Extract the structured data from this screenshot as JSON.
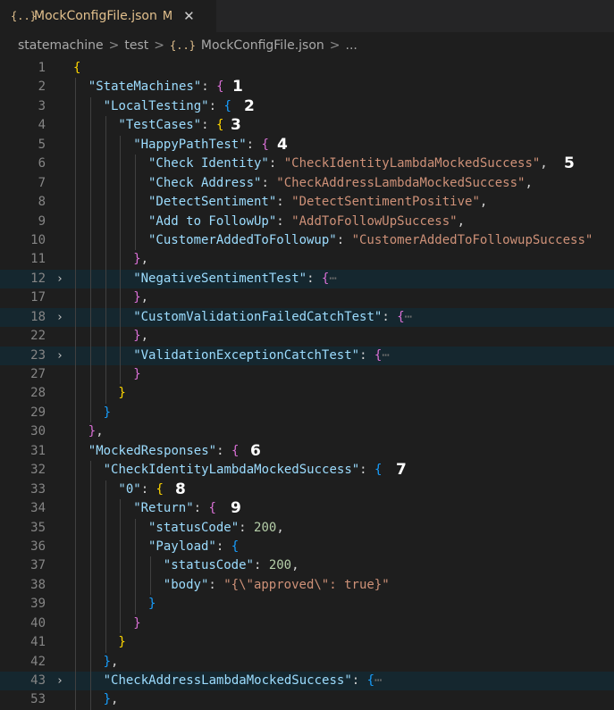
{
  "tab": {
    "icon": "{..}",
    "filename": "MockConfigFile.json",
    "modified": "M",
    "close": "✕"
  },
  "breadcrumb": {
    "items": [
      "statemachine",
      "test",
      "MockConfigFile.json",
      "..."
    ],
    "separator": ">",
    "file_icon": "{..}"
  },
  "editor": {
    "lines": [
      {
        "num": "1",
        "ann": "",
        "fold": false,
        "hl": false
      },
      {
        "num": "2",
        "ann": "1",
        "fold": false,
        "hl": false
      },
      {
        "num": "3",
        "ann": "2",
        "fold": false,
        "hl": false
      },
      {
        "num": "4",
        "ann": "3",
        "fold": false,
        "hl": false
      },
      {
        "num": "5",
        "ann": "4",
        "fold": false,
        "hl": false
      },
      {
        "num": "6",
        "ann": "5",
        "fold": false,
        "hl": false
      },
      {
        "num": "7",
        "ann": "",
        "fold": false,
        "hl": false
      },
      {
        "num": "8",
        "ann": "",
        "fold": false,
        "hl": false
      },
      {
        "num": "9",
        "ann": "",
        "fold": false,
        "hl": false
      },
      {
        "num": "10",
        "ann": "",
        "fold": false,
        "hl": false
      },
      {
        "num": "11",
        "ann": "",
        "fold": false,
        "hl": false
      },
      {
        "num": "12",
        "ann": "",
        "fold": true,
        "hl": true
      },
      {
        "num": "17",
        "ann": "",
        "fold": false,
        "hl": false
      },
      {
        "num": "18",
        "ann": "",
        "fold": true,
        "hl": true
      },
      {
        "num": "22",
        "ann": "",
        "fold": false,
        "hl": false
      },
      {
        "num": "23",
        "ann": "",
        "fold": true,
        "hl": true
      },
      {
        "num": "27",
        "ann": "",
        "fold": false,
        "hl": false
      },
      {
        "num": "28",
        "ann": "",
        "fold": false,
        "hl": false
      },
      {
        "num": "29",
        "ann": "",
        "fold": false,
        "hl": false
      },
      {
        "num": "30",
        "ann": "",
        "fold": false,
        "hl": false
      },
      {
        "num": "31",
        "ann": "6",
        "fold": false,
        "hl": false
      },
      {
        "num": "32",
        "ann": "7",
        "fold": false,
        "hl": false
      },
      {
        "num": "33",
        "ann": "8",
        "fold": false,
        "hl": false
      },
      {
        "num": "34",
        "ann": "9",
        "fold": false,
        "hl": false
      },
      {
        "num": "35",
        "ann": "",
        "fold": false,
        "hl": false
      },
      {
        "num": "36",
        "ann": "",
        "fold": false,
        "hl": false
      },
      {
        "num": "37",
        "ann": "",
        "fold": false,
        "hl": false
      },
      {
        "num": "38",
        "ann": "",
        "fold": false,
        "hl": false
      },
      {
        "num": "39",
        "ann": "",
        "fold": false,
        "hl": false
      },
      {
        "num": "40",
        "ann": "",
        "fold": false,
        "hl": false
      },
      {
        "num": "41",
        "ann": "",
        "fold": false,
        "hl": false
      },
      {
        "num": "42",
        "ann": "",
        "fold": false,
        "hl": false
      },
      {
        "num": "43",
        "ann": "",
        "fold": true,
        "hl": true
      },
      {
        "num": "53",
        "ann": "",
        "fold": false,
        "hl": false
      }
    ],
    "tokens": [
      [
        [
          "b1",
          "{"
        ]
      ],
      [
        [
          "k",
          "\"StateMachines\""
        ],
        [
          "p",
          ": "
        ],
        [
          "b2",
          "{"
        ]
      ],
      [
        [
          "k",
          "\"LocalTesting\""
        ],
        [
          "p",
          ": "
        ],
        [
          "b3",
          "{"
        ]
      ],
      [
        [
          "k",
          "\"TestCases\""
        ],
        [
          "p",
          ": "
        ],
        [
          "b1",
          "{"
        ]
      ],
      [
        [
          "k",
          "\"HappyPathTest\""
        ],
        [
          "p",
          ": "
        ],
        [
          "b2",
          "{"
        ]
      ],
      [
        [
          "k",
          "\"Check Identity\""
        ],
        [
          "p",
          ": "
        ],
        [
          "s",
          "\"CheckIdentityLambdaMockedSuccess\""
        ],
        [
          "p",
          ","
        ]
      ],
      [
        [
          "k",
          "\"Check Address\""
        ],
        [
          "p",
          ": "
        ],
        [
          "s",
          "\"CheckAddressLambdaMockedSuccess\""
        ],
        [
          "p",
          ","
        ]
      ],
      [
        [
          "k",
          "\"DetectSentiment\""
        ],
        [
          "p",
          ": "
        ],
        [
          "s",
          "\"DetectSentimentPositive\""
        ],
        [
          "p",
          ","
        ]
      ],
      [
        [
          "k",
          "\"Add to FollowUp\""
        ],
        [
          "p",
          ": "
        ],
        [
          "s",
          "\"AddToFollowUpSuccess\""
        ],
        [
          "p",
          ","
        ]
      ],
      [
        [
          "k",
          "\"CustomerAddedToFollowup\""
        ],
        [
          "p",
          ": "
        ],
        [
          "s",
          "\"CustomerAddedToFollowupSuccess\""
        ]
      ],
      [
        [
          "b2",
          "}"
        ],
        [
          "p",
          ","
        ]
      ],
      [
        [
          "k",
          "\"NegativeSentimentTest\""
        ],
        [
          "p",
          ": "
        ],
        [
          "b2",
          "{"
        ],
        [
          "ell",
          "⋯"
        ]
      ],
      [
        [
          "b2",
          "}"
        ],
        [
          "p",
          ","
        ]
      ],
      [
        [
          "k",
          "\"CustomValidationFailedCatchTest\""
        ],
        [
          "p",
          ": "
        ],
        [
          "b2",
          "{"
        ],
        [
          "ell",
          "⋯"
        ]
      ],
      [
        [
          "b2",
          "}"
        ],
        [
          "p",
          ","
        ]
      ],
      [
        [
          "k",
          "\"ValidationExceptionCatchTest\""
        ],
        [
          "p",
          ": "
        ],
        [
          "b2",
          "{"
        ],
        [
          "ell",
          "⋯"
        ]
      ],
      [
        [
          "b2",
          "}"
        ]
      ],
      [
        [
          "b1",
          "}"
        ]
      ],
      [
        [
          "b3",
          "}"
        ]
      ],
      [
        [
          "b2",
          "}"
        ],
        [
          "p",
          ","
        ]
      ],
      [
        [
          "k",
          "\"MockedResponses\""
        ],
        [
          "p",
          ": "
        ],
        [
          "b2",
          "{"
        ]
      ],
      [
        [
          "k",
          "\"CheckIdentityLambdaMockedSuccess\""
        ],
        [
          "p",
          ": "
        ],
        [
          "b3",
          "{"
        ]
      ],
      [
        [
          "k",
          "\"0\""
        ],
        [
          "p",
          ": "
        ],
        [
          "b1",
          "{"
        ]
      ],
      [
        [
          "k",
          "\"Return\""
        ],
        [
          "p",
          ": "
        ],
        [
          "b2",
          "{"
        ]
      ],
      [
        [
          "k",
          "\"statusCode\""
        ],
        [
          "p",
          ": "
        ],
        [
          "n",
          "200"
        ],
        [
          "p",
          ","
        ]
      ],
      [
        [
          "k",
          "\"Payload\""
        ],
        [
          "p",
          ": "
        ],
        [
          "b3",
          "{"
        ]
      ],
      [
        [
          "k",
          "\"statusCode\""
        ],
        [
          "p",
          ": "
        ],
        [
          "n",
          "200"
        ],
        [
          "p",
          ","
        ]
      ],
      [
        [
          "k",
          "\"body\""
        ],
        [
          "p",
          ": "
        ],
        [
          "s",
          "\"{\\\"approved\\\": true}\""
        ]
      ],
      [
        [
          "b3",
          "}"
        ]
      ],
      [
        [
          "b2",
          "}"
        ]
      ],
      [
        [
          "b1",
          "}"
        ]
      ],
      [
        [
          "b3",
          "}"
        ],
        [
          "p",
          ","
        ]
      ],
      [
        [
          "k",
          "\"CheckAddressLambdaMockedSuccess\""
        ],
        [
          "p",
          ": "
        ],
        [
          "b3",
          "{"
        ],
        [
          "ell",
          "⋯"
        ]
      ],
      [
        [
          "b3",
          "}"
        ],
        [
          "p",
          ","
        ]
      ]
    ]
  },
  "colors": {
    "background": "#1e1e1e",
    "key": "#9cdcfe",
    "string": "#ce9178",
    "number": "#b5cea8",
    "bracket_gold": "#ffd700",
    "bracket_orchid": "#da70d6",
    "bracket_blue": "#179fff",
    "folded_highlight": "#15272f"
  },
  "icons": {
    "tab_file": "json-file-icon",
    "breadcrumb_file": "json-file-icon",
    "fold": "chevron-right-icon",
    "close": "close-icon"
  }
}
